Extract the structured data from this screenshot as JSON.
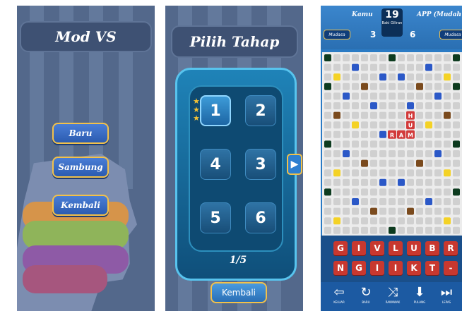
{
  "mod_vs": {
    "title": "Mod VS",
    "buttons": [
      "Baru",
      "Sambung",
      "Kembali"
    ]
  },
  "pilih_tahap": {
    "title": "Pilih Tahap",
    "levels": [
      "1",
      "2",
      "4",
      "3",
      "5",
      "6"
    ],
    "page_indicator": "1/5",
    "back_label": "Kembali",
    "next_icon": "play-arrow-icon"
  },
  "game": {
    "player_label": "Kamu",
    "player_score": "3",
    "center_count": "19",
    "center_caption": "Baki Giliran",
    "opponent_label": "APP (Mudah",
    "opponent_score": "6",
    "left_pill": "Mudasa",
    "right_pill": "Mudasa",
    "board_letters": [
      "H",
      "U",
      "R",
      "A",
      "M"
    ],
    "rack_row1": [
      "G",
      "I",
      "V",
      "L",
      "U",
      "B",
      "R"
    ],
    "rack_row2": [
      "N",
      "G",
      "I",
      "I",
      "K",
      "T",
      "-"
    ],
    "actions": [
      {
        "icon": "exit-icon",
        "label": "KELUAR"
      },
      {
        "icon": "refresh-icon",
        "label": "BARU"
      },
      {
        "icon": "shuffle-icon",
        "label": "RAWAWAK"
      },
      {
        "icon": "download-icon",
        "label": "PULANG"
      },
      {
        "icon": "skip-icon",
        "label": "LEPAS"
      }
    ],
    "colors": {
      "red_tile": "#d23a3a",
      "blue_cell": "#2b58c7",
      "yellow_cell": "#f4d226",
      "dark_cell": "#0d3b1f",
      "brown_cell": "#7a4a1d"
    }
  }
}
